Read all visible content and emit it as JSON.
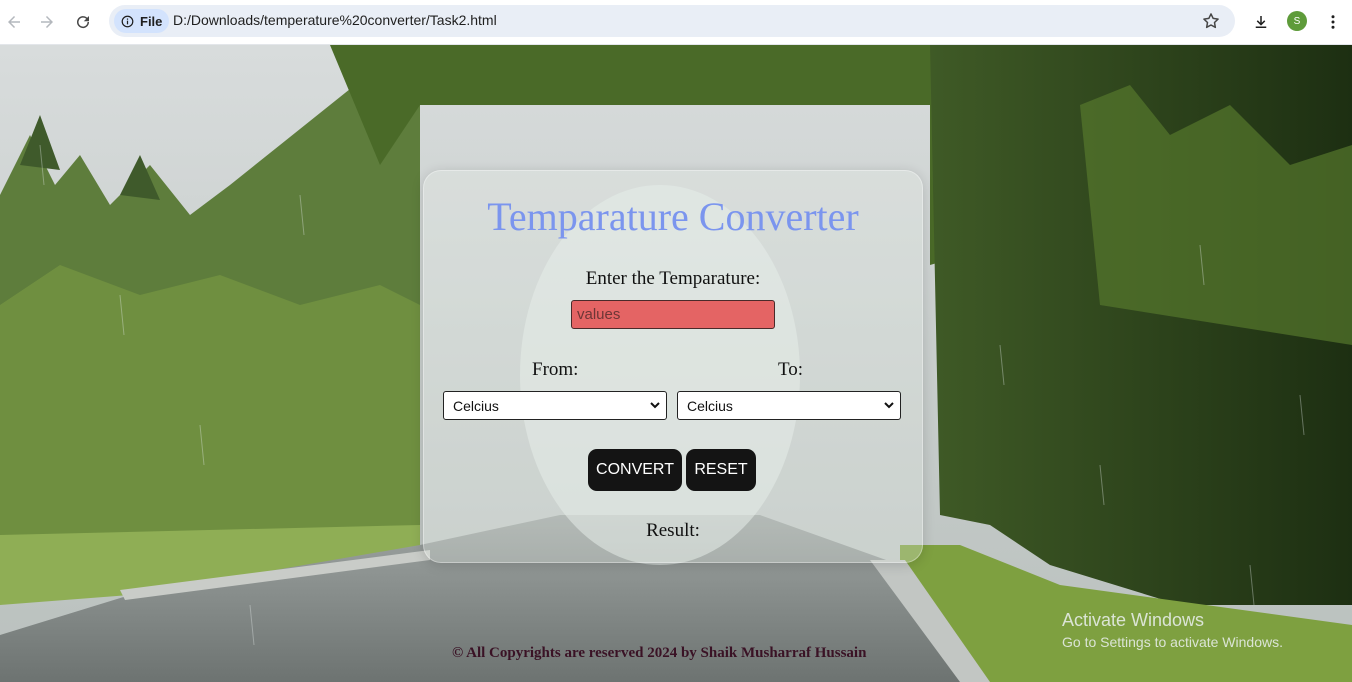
{
  "browser": {
    "site_chip_label": "File",
    "url": "D:/Downloads/temperature%20converter/Task2.html",
    "profile_initial": "S"
  },
  "converter": {
    "title": "Temparature Converter",
    "prompt_label": "Enter the Temparature:",
    "input_placeholder": "values",
    "input_value": "",
    "from_label": "From:",
    "to_label": "To:",
    "from_selected": "Celcius",
    "to_selected": "Celcius",
    "convert_label": "CONVERT",
    "reset_label": "RESET",
    "result_label": "Result:"
  },
  "footer": {
    "text": "© All Copyrights are reserved 2024 by Shaik Musharraf Hussain"
  },
  "watermark": {
    "line1": "Activate Windows",
    "line2": "Go to Settings to activate Windows."
  },
  "colors": {
    "title": "#7b95ee",
    "input_bg": "#e46464",
    "button_bg": "#141414",
    "footer_text": "#3a1225",
    "profile_bg": "#5e9b3a"
  }
}
